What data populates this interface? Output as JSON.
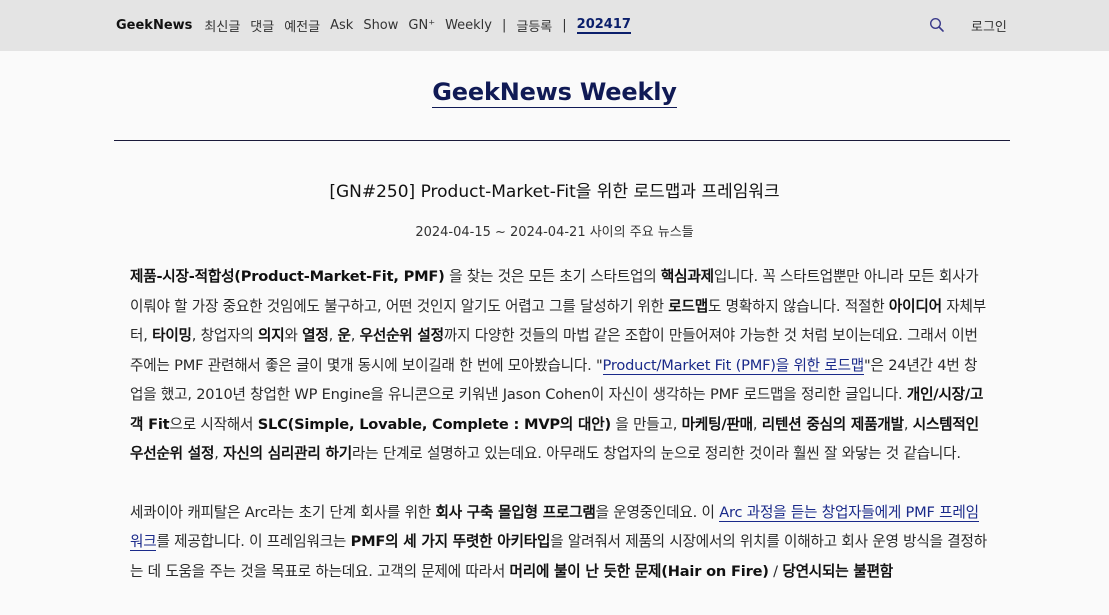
{
  "nav": {
    "brand": "GeekNews",
    "items": [
      "최신글",
      "댓글",
      "예전글",
      "Ask",
      "Show",
      "GN⁺",
      "Weekly"
    ],
    "sep1": "|",
    "submit": "글등록",
    "sep2": "|",
    "number": "202417",
    "search_icon": "search-icon",
    "login": "로그인"
  },
  "page": {
    "title": "GeekNews Weekly",
    "headline": "[GN#250] Product-Market-Fit을 위한 로드맵과 프레임워크",
    "daterange": "2024-04-15 ~ 2024-04-21 사이의 주요 뉴스들"
  },
  "p1": {
    "s1b": "제품-시장-적합성(Product-Market-Fit, PMF)",
    "s2": " 을 찾는 것은 모든 초기 스타트업의 ",
    "s3b": "핵심과제",
    "s4": "입니다. 꼭 스타트업뿐만 아니라 모든 회사가 이뤄야 할 가장 중요한 것임에도 불구하고, 어떤 것인지 알기도 어렵고 그를 달성하기 위한 ",
    "s5b": "로드맵",
    "s6": "도 명확하지 않습니다. 적절한 ",
    "s7b": "아이디어",
    "s8": " 자체부터, ",
    "s9b": "타이밍",
    "s10": ", 창업자의 ",
    "s11b": "의지",
    "s12": "와 ",
    "s13b": "열정",
    "s14": ", ",
    "s15b": "운",
    "s16": ", ",
    "s17b": "우선순위 설정",
    "s18": "까지 다양한 것들의 마법 같은 조합이 만들어져야 가능한 것 처럼 보이는데요. 그래서 이번 주에는 PMF 관련해서 좋은 글이 몇개 동시에 보이길래 한 번에 모아봤습니다. \"",
    "s19l": "Product/Market Fit (PMF)을 위한 로드맵",
    "s20": "\"은 24년간 4번 창업을 했고, 2010년 창업한 WP Engine을 유니콘으로 키워낸 Jason Cohen이 자신이 생각하는 PMF 로드맵을 정리한 글입니다. ",
    "s21b": "개인/시장/고객 Fit",
    "s22": "으로 시작해서 ",
    "s23b": "SLC(Simple, Lovable, Complete : MVP의 대안)",
    "s24": " 을 만들고, ",
    "s25b": "마케팅/판매",
    "s26": ", ",
    "s27b": "리텐션 중심의 제품개발",
    "s28": ", ",
    "s29b": "시스템적인 우선순위 설정",
    "s30": ", ",
    "s31b": "자신의 심리관리 하기",
    "s32": "라는 단계로 설명하고 있는데요. 아무래도 창업자의 눈으로 정리한 것이라 훨씬 잘 와닿는 것 같습니다."
  },
  "p2": {
    "s1": "세콰이아 캐피탈은 Arc라는 초기 단계 회사를 위한 ",
    "s2b": "회사 구축 몰입형 프로그램",
    "s3": "을 운영중인데요. 이 ",
    "s4l": "Arc 과정을 듣는 창업자들에게 PMF 프레임워크",
    "s5": "를 제공합니다. 이 프레임워크는 ",
    "s6b": "PMF의 세 가지 뚜렷한 아키타입",
    "s7": "을 알려줘서 제품의 시장에서의 위치를 이해하고 회사 운영 방식을 결정하는 데 도움을 주는 것을 목표로 하는데요. 고객의 문제에 따라서 ",
    "s8b": "머리에 불이 난 듯한 문제(Hair on Fire)",
    "s9": " / ",
    "s10b": "당연시되는 불편함"
  }
}
